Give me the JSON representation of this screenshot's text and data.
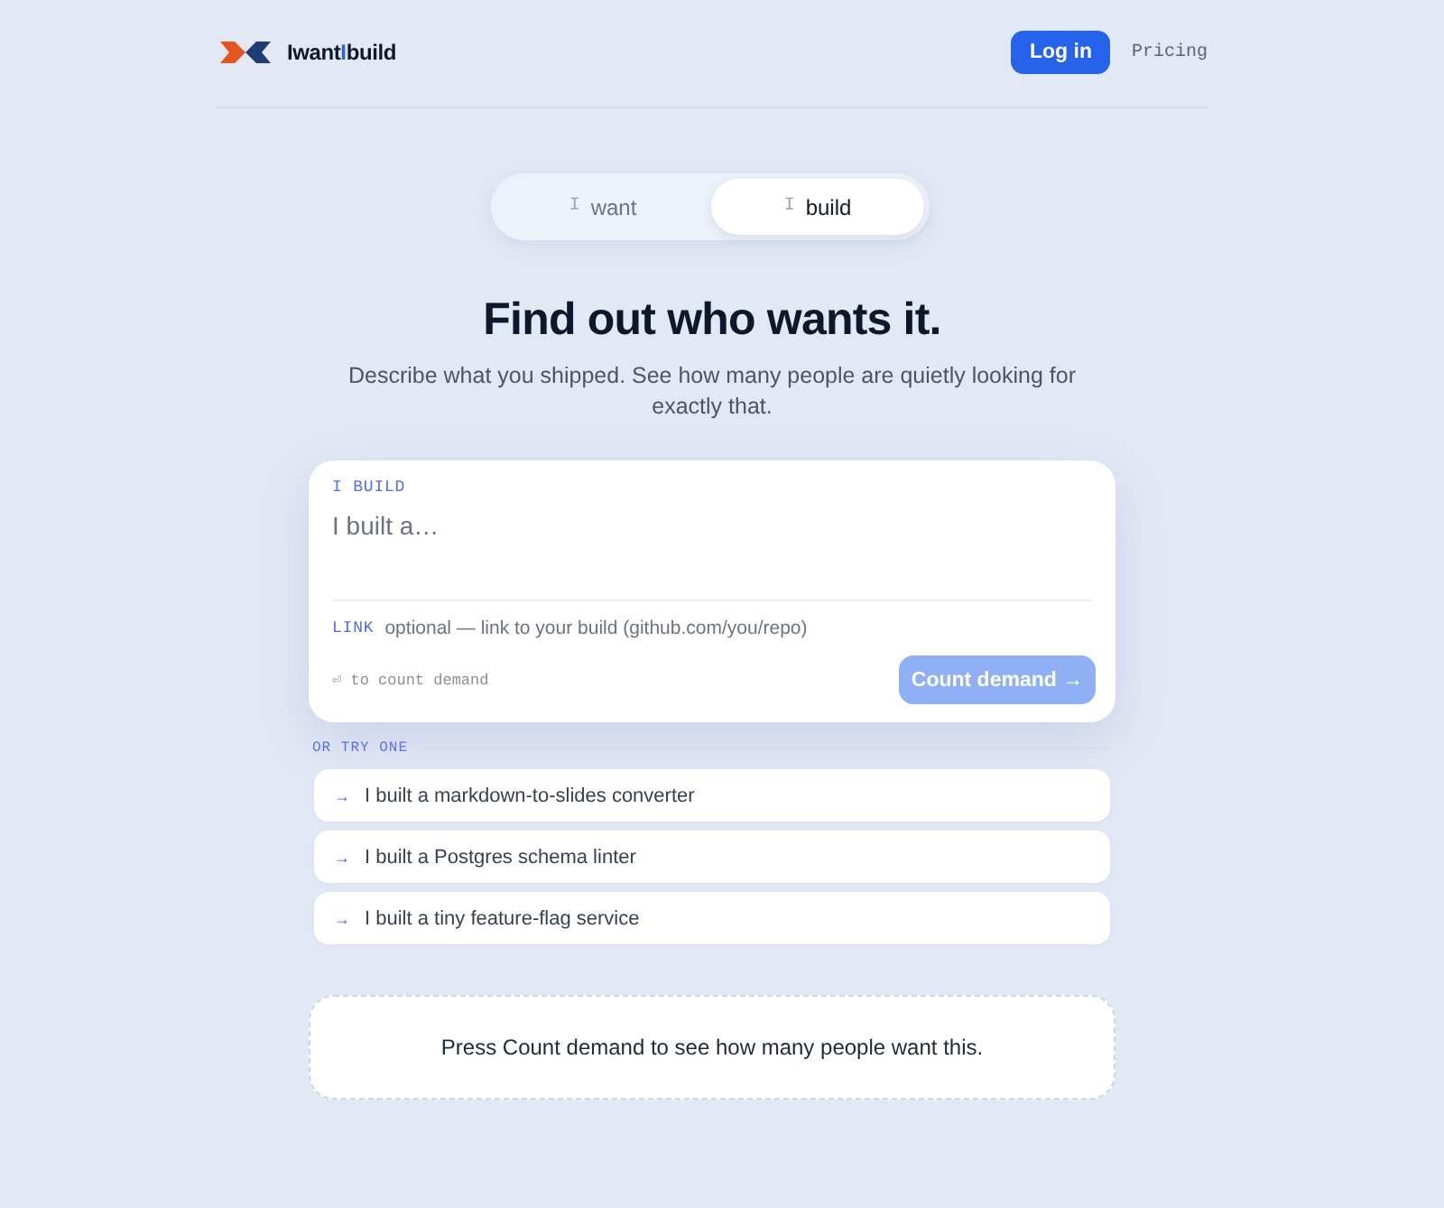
{
  "brand": {
    "before": "Iwant",
    "accent": "I",
    "after": "build"
  },
  "nav": [
    {
      "label": "Log in",
      "kind": "primary"
    },
    {
      "label": "Pricing",
      "kind": "link"
    }
  ],
  "mode_tabs": [
    {
      "glyph": "I",
      "label": "want",
      "selected": false
    },
    {
      "glyph": "I",
      "label": "build",
      "selected": true
    }
  ],
  "hero": {
    "title": "Find out who wants it.",
    "subtitle": "Describe what you shipped. See how many people are quietly looking for exactly that."
  },
  "composer": {
    "label": "I BUILD",
    "placeholder": "I built a…",
    "link_label": "LINK",
    "link_placeholder": "optional — link to your build (github.com/you/repo)",
    "hint": "⏎ to count demand",
    "submit": {
      "label": "Count demand →",
      "disabled": true
    }
  },
  "suggestions": {
    "heading": "OR TRY ONE",
    "items": [
      {
        "arrow": "→",
        "text": "I built a markdown-to-slides converter"
      },
      {
        "arrow": "→",
        "text": "I built a Postgres schema linter"
      },
      {
        "arrow": "→",
        "text": "I built a tiny feature-flag service"
      }
    ]
  },
  "result": {
    "message": "Press Count demand to see how many people want this."
  }
}
